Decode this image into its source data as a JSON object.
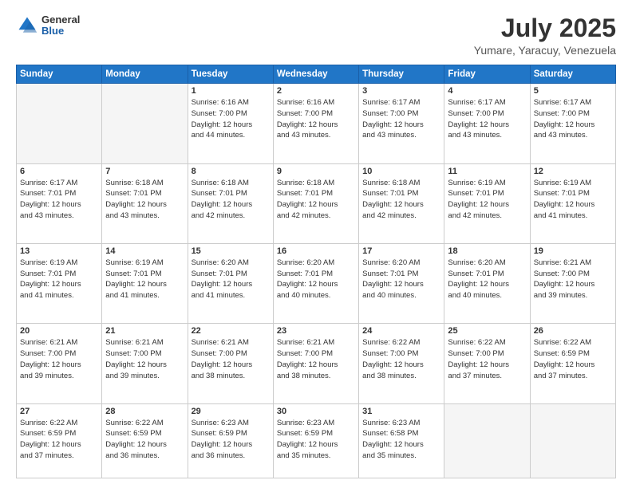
{
  "header": {
    "logo_general": "General",
    "logo_blue": "Blue",
    "month_year": "July 2025",
    "location": "Yumare, Yaracuy, Venezuela"
  },
  "days_of_week": [
    "Sunday",
    "Monday",
    "Tuesday",
    "Wednesday",
    "Thursday",
    "Friday",
    "Saturday"
  ],
  "weeks": [
    [
      {
        "day": "",
        "info": []
      },
      {
        "day": "",
        "info": []
      },
      {
        "day": "1",
        "info": [
          "Sunrise: 6:16 AM",
          "Sunset: 7:00 PM",
          "Daylight: 12 hours",
          "and 44 minutes."
        ]
      },
      {
        "day": "2",
        "info": [
          "Sunrise: 6:16 AM",
          "Sunset: 7:00 PM",
          "Daylight: 12 hours",
          "and 43 minutes."
        ]
      },
      {
        "day": "3",
        "info": [
          "Sunrise: 6:17 AM",
          "Sunset: 7:00 PM",
          "Daylight: 12 hours",
          "and 43 minutes."
        ]
      },
      {
        "day": "4",
        "info": [
          "Sunrise: 6:17 AM",
          "Sunset: 7:00 PM",
          "Daylight: 12 hours",
          "and 43 minutes."
        ]
      },
      {
        "day": "5",
        "info": [
          "Sunrise: 6:17 AM",
          "Sunset: 7:00 PM",
          "Daylight: 12 hours",
          "and 43 minutes."
        ]
      }
    ],
    [
      {
        "day": "6",
        "info": [
          "Sunrise: 6:17 AM",
          "Sunset: 7:01 PM",
          "Daylight: 12 hours",
          "and 43 minutes."
        ]
      },
      {
        "day": "7",
        "info": [
          "Sunrise: 6:18 AM",
          "Sunset: 7:01 PM",
          "Daylight: 12 hours",
          "and 43 minutes."
        ]
      },
      {
        "day": "8",
        "info": [
          "Sunrise: 6:18 AM",
          "Sunset: 7:01 PM",
          "Daylight: 12 hours",
          "and 42 minutes."
        ]
      },
      {
        "day": "9",
        "info": [
          "Sunrise: 6:18 AM",
          "Sunset: 7:01 PM",
          "Daylight: 12 hours",
          "and 42 minutes."
        ]
      },
      {
        "day": "10",
        "info": [
          "Sunrise: 6:18 AM",
          "Sunset: 7:01 PM",
          "Daylight: 12 hours",
          "and 42 minutes."
        ]
      },
      {
        "day": "11",
        "info": [
          "Sunrise: 6:19 AM",
          "Sunset: 7:01 PM",
          "Daylight: 12 hours",
          "and 42 minutes."
        ]
      },
      {
        "day": "12",
        "info": [
          "Sunrise: 6:19 AM",
          "Sunset: 7:01 PM",
          "Daylight: 12 hours",
          "and 41 minutes."
        ]
      }
    ],
    [
      {
        "day": "13",
        "info": [
          "Sunrise: 6:19 AM",
          "Sunset: 7:01 PM",
          "Daylight: 12 hours",
          "and 41 minutes."
        ]
      },
      {
        "day": "14",
        "info": [
          "Sunrise: 6:19 AM",
          "Sunset: 7:01 PM",
          "Daylight: 12 hours",
          "and 41 minutes."
        ]
      },
      {
        "day": "15",
        "info": [
          "Sunrise: 6:20 AM",
          "Sunset: 7:01 PM",
          "Daylight: 12 hours",
          "and 41 minutes."
        ]
      },
      {
        "day": "16",
        "info": [
          "Sunrise: 6:20 AM",
          "Sunset: 7:01 PM",
          "Daylight: 12 hours",
          "and 40 minutes."
        ]
      },
      {
        "day": "17",
        "info": [
          "Sunrise: 6:20 AM",
          "Sunset: 7:01 PM",
          "Daylight: 12 hours",
          "and 40 minutes."
        ]
      },
      {
        "day": "18",
        "info": [
          "Sunrise: 6:20 AM",
          "Sunset: 7:01 PM",
          "Daylight: 12 hours",
          "and 40 minutes."
        ]
      },
      {
        "day": "19",
        "info": [
          "Sunrise: 6:21 AM",
          "Sunset: 7:00 PM",
          "Daylight: 12 hours",
          "and 39 minutes."
        ]
      }
    ],
    [
      {
        "day": "20",
        "info": [
          "Sunrise: 6:21 AM",
          "Sunset: 7:00 PM",
          "Daylight: 12 hours",
          "and 39 minutes."
        ]
      },
      {
        "day": "21",
        "info": [
          "Sunrise: 6:21 AM",
          "Sunset: 7:00 PM",
          "Daylight: 12 hours",
          "and 39 minutes."
        ]
      },
      {
        "day": "22",
        "info": [
          "Sunrise: 6:21 AM",
          "Sunset: 7:00 PM",
          "Daylight: 12 hours",
          "and 38 minutes."
        ]
      },
      {
        "day": "23",
        "info": [
          "Sunrise: 6:21 AM",
          "Sunset: 7:00 PM",
          "Daylight: 12 hours",
          "and 38 minutes."
        ]
      },
      {
        "day": "24",
        "info": [
          "Sunrise: 6:22 AM",
          "Sunset: 7:00 PM",
          "Daylight: 12 hours",
          "and 38 minutes."
        ]
      },
      {
        "day": "25",
        "info": [
          "Sunrise: 6:22 AM",
          "Sunset: 7:00 PM",
          "Daylight: 12 hours",
          "and 37 minutes."
        ]
      },
      {
        "day": "26",
        "info": [
          "Sunrise: 6:22 AM",
          "Sunset: 6:59 PM",
          "Daylight: 12 hours",
          "and 37 minutes."
        ]
      }
    ],
    [
      {
        "day": "27",
        "info": [
          "Sunrise: 6:22 AM",
          "Sunset: 6:59 PM",
          "Daylight: 12 hours",
          "and 37 minutes."
        ]
      },
      {
        "day": "28",
        "info": [
          "Sunrise: 6:22 AM",
          "Sunset: 6:59 PM",
          "Daylight: 12 hours",
          "and 36 minutes."
        ]
      },
      {
        "day": "29",
        "info": [
          "Sunrise: 6:23 AM",
          "Sunset: 6:59 PM",
          "Daylight: 12 hours",
          "and 36 minutes."
        ]
      },
      {
        "day": "30",
        "info": [
          "Sunrise: 6:23 AM",
          "Sunset: 6:59 PM",
          "Daylight: 12 hours",
          "and 35 minutes."
        ]
      },
      {
        "day": "31",
        "info": [
          "Sunrise: 6:23 AM",
          "Sunset: 6:58 PM",
          "Daylight: 12 hours",
          "and 35 minutes."
        ]
      },
      {
        "day": "",
        "info": []
      },
      {
        "day": "",
        "info": []
      }
    ]
  ]
}
